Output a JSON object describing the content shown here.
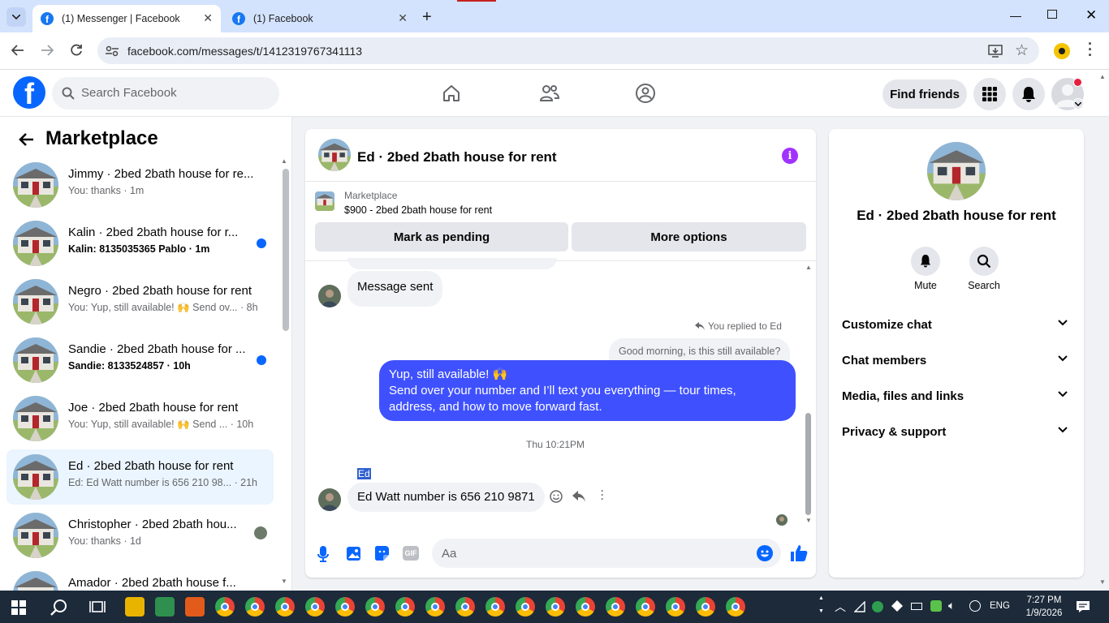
{
  "browser": {
    "tabs": [
      {
        "title": "(1) Messenger | Facebook",
        "active": true
      },
      {
        "title": "(1) Facebook",
        "active": false
      }
    ],
    "url": "facebook.com/messages/t/1412319767341113"
  },
  "header": {
    "search_placeholder": "Search Facebook",
    "find_friends": "Find friends"
  },
  "sidebar": {
    "title": "Marketplace",
    "conversations": [
      {
        "name": "Jimmy · 2bed 2bath house for re...",
        "preview": "You: thanks · 1m",
        "unread": false,
        "selected": false
      },
      {
        "name": "Kalin · 2bed 2bath house for r...",
        "preview": "Kalin: 8135035365 Pablo · 1m",
        "unread": true,
        "selected": false
      },
      {
        "name": "Negro · 2bed 2bath house for rent",
        "preview": "You: Yup, still available! 🙌 Send ov... · 8h",
        "unread": false,
        "selected": false
      },
      {
        "name": "Sandie · 2bed 2bath house for ...",
        "preview": "Sandie: 8133524857 · 10h",
        "unread": true,
        "selected": false
      },
      {
        "name": "Joe · 2bed 2bath house for rent",
        "preview": "You: Yup, still available! 🙌 Send ... · 10h",
        "unread": false,
        "selected": false
      },
      {
        "name": "Ed · 2bed 2bath house for rent",
        "preview": "Ed: Ed Watt number is 656 210 98... · 21h",
        "unread": false,
        "selected": true
      },
      {
        "name": "Christopher · 2bed 2bath hou...",
        "preview": "You: thanks · 1d",
        "unread": false,
        "selected": false
      },
      {
        "name": "Amador · 2bed 2bath house f...",
        "preview": "",
        "unread": false,
        "selected": false
      }
    ]
  },
  "chat": {
    "title": "Ed · 2bed 2bath house for rent",
    "marketplace_label": "Marketplace",
    "listing": "$900 - 2bed 2bath house for rent",
    "mark_pending": "Mark as pending",
    "more_options": "More options",
    "messages": {
      "sent_notice": "Message sent",
      "replied_label": "You replied to Ed",
      "quoted": "Good morning, is this still available?",
      "reply_line1": "Yup, still available! 🙌",
      "reply_line2": "Send over your number and I’ll text you everything — tour times, address, and how to move forward fast.",
      "timestamp": "Thu 10:21PM",
      "sender_label": "Ed",
      "incoming": "Ed Watt number is 656 210 9871"
    },
    "composer_placeholder": "Aa"
  },
  "details": {
    "title": "Ed · 2bed 2bath house for rent",
    "mute": "Mute",
    "search": "Search",
    "sections": [
      "Customize chat",
      "Chat members",
      "Media, files and links",
      "Privacy & support"
    ]
  },
  "taskbar": {
    "lang": "ENG",
    "time": "7:27 PM",
    "date": "1/9/2026"
  },
  "colors": {
    "fb_blue": "#0866ff",
    "bubble_blue": "#3f51ff",
    "accent_purple": "#a033ff"
  }
}
